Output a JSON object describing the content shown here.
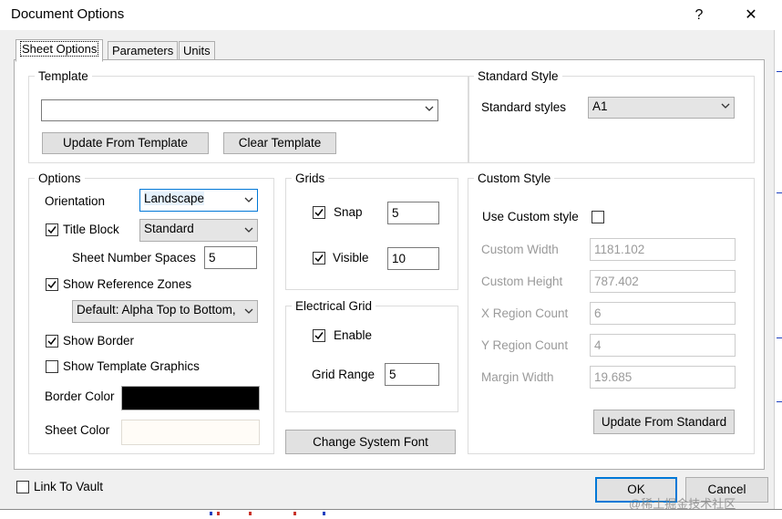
{
  "window": {
    "title": "Document Options",
    "help_glyph": "?",
    "close_glyph": "✕"
  },
  "tabs": [
    {
      "label": "Sheet Options",
      "active": true
    },
    {
      "label": "Parameters",
      "active": false
    },
    {
      "label": "Units",
      "active": false
    }
  ],
  "template": {
    "group_label": "Template",
    "value": "",
    "update_button": "Update From Template",
    "clear_button": "Clear Template"
  },
  "standard_style": {
    "group_label": "Standard Style",
    "label": "Standard styles",
    "value": "A1"
  },
  "options": {
    "group_label": "Options",
    "orientation_label": "Orientation",
    "orientation_value": "Landscape",
    "title_block_label": "Title Block",
    "title_block_checked": true,
    "title_block_value": "Standard",
    "sheet_number_spaces_label": "Sheet Number Spaces",
    "sheet_number_spaces_value": "5",
    "show_reference_zones_label": "Show Reference Zones",
    "show_reference_zones_checked": true,
    "reference_zones_value": "Default: Alpha Top to Bottom,",
    "show_border_label": "Show Border",
    "show_border_checked": true,
    "show_template_graphics_label": "Show Template Graphics",
    "show_template_graphics_checked": false,
    "border_color_label": "Border Color",
    "border_color": "#000000",
    "sheet_color_label": "Sheet Color",
    "sheet_color": "#fffcf7"
  },
  "grids": {
    "group_label": "Grids",
    "snap_label": "Snap",
    "snap_checked": true,
    "snap_value": "5",
    "visible_label": "Visible",
    "visible_checked": true,
    "visible_value": "10"
  },
  "electrical_grid": {
    "group_label": "Electrical Grid",
    "enable_label": "Enable",
    "enable_checked": true,
    "range_label": "Grid Range",
    "range_value": "5"
  },
  "change_font_button": "Change System Font",
  "custom_style": {
    "group_label": "Custom Style",
    "use_custom_label": "Use Custom style",
    "use_custom_checked": false,
    "width_label": "Custom Width",
    "width_value": "1181.102",
    "height_label": "Custom Height",
    "height_value": "787.402",
    "x_region_label": "X Region Count",
    "x_region_value": "6",
    "y_region_label": "Y Region Count",
    "y_region_value": "4",
    "margin_label": "Margin Width",
    "margin_value": "19.685",
    "update_button": "Update From Standard"
  },
  "footer": {
    "link_to_vault_label": "Link To Vault",
    "link_to_vault_checked": false,
    "ok_button": "OK",
    "cancel_button": "Cancel",
    "watermark": "@稀土掘金技术社区"
  },
  "colors": {
    "accent": "#0078d7",
    "panel": "#f0f0f0"
  }
}
